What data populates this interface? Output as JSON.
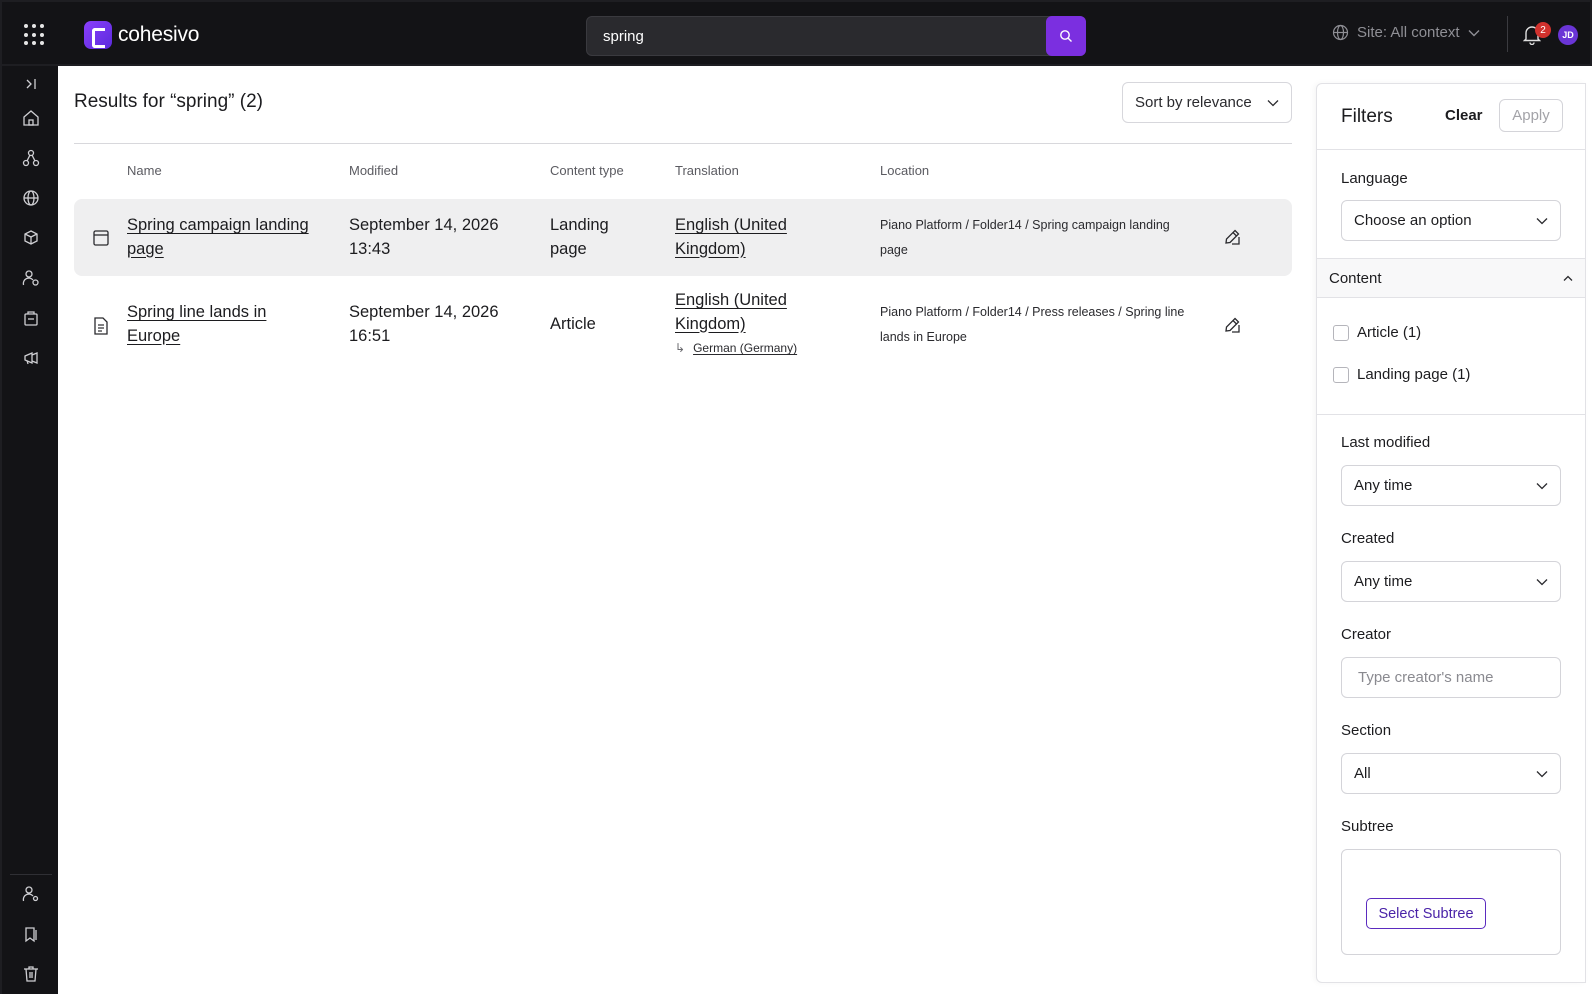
{
  "app": {
    "logo_text": "cohesivo"
  },
  "header": {
    "search_value": "spring",
    "site_context": "Site: All context",
    "notification_count": "2",
    "avatar_initials": "JD"
  },
  "sidebar": {
    "items": [
      "collapse",
      "home",
      "structure",
      "globe",
      "products",
      "personalization",
      "commerce",
      "marketing"
    ],
    "bottom_items": [
      "user-settings",
      "bookmarks",
      "trash"
    ]
  },
  "results": {
    "title": "Results for “spring” (2)",
    "sort_label": "Sort by relevance",
    "columns": [
      "Name",
      "Modified",
      "Content type",
      "Translation",
      "Location"
    ],
    "rows": [
      {
        "icon": "landing-page-icon",
        "name_line1": "Spring campaign landing",
        "name_line2": "page",
        "modified_line1": "September 14, 2026",
        "modified_line2": "13:43",
        "type_line1": "Landing",
        "type_line2": "page",
        "translation_line1": "English (United",
        "translation_line2": "Kingdom)",
        "location_line1": "Piano Platform / Folder14 / Spring campaign landing",
        "location_line2": "page"
      },
      {
        "icon": "article-icon",
        "name_line1": "Spring line lands in",
        "name_line2": "Europe",
        "modified_line1": "September 14, 2026",
        "modified_line2": "16:51",
        "type_line1": "Article",
        "translation_line1": "English (United",
        "translation_line2": "Kingdom)",
        "sub_translation": "German (Germany)",
        "location_line1": "Piano Platform / Folder14 / Press releases / Spring line",
        "location_line2": "lands in Europe"
      }
    ]
  },
  "filters": {
    "title": "Filters",
    "clear_label": "Clear",
    "apply_label": "Apply",
    "language_label": "Language",
    "language_value": "Choose an option",
    "content_label": "Content",
    "content_options": [
      "Article (1)",
      "Landing page (1)"
    ],
    "last_modified_label": "Last modified",
    "last_modified_value": "Any time",
    "created_label": "Created",
    "created_value": "Any time",
    "creator_label": "Creator",
    "creator_placeholder": "Type creator's name",
    "section_label": "Section",
    "section_value": "All",
    "subtree_label": "Subtree",
    "subtree_button": "Select Subtree"
  },
  "colors": {
    "accent": "#7b2fe0",
    "topbar": "#131316",
    "row_highlight": "#efeff0"
  }
}
